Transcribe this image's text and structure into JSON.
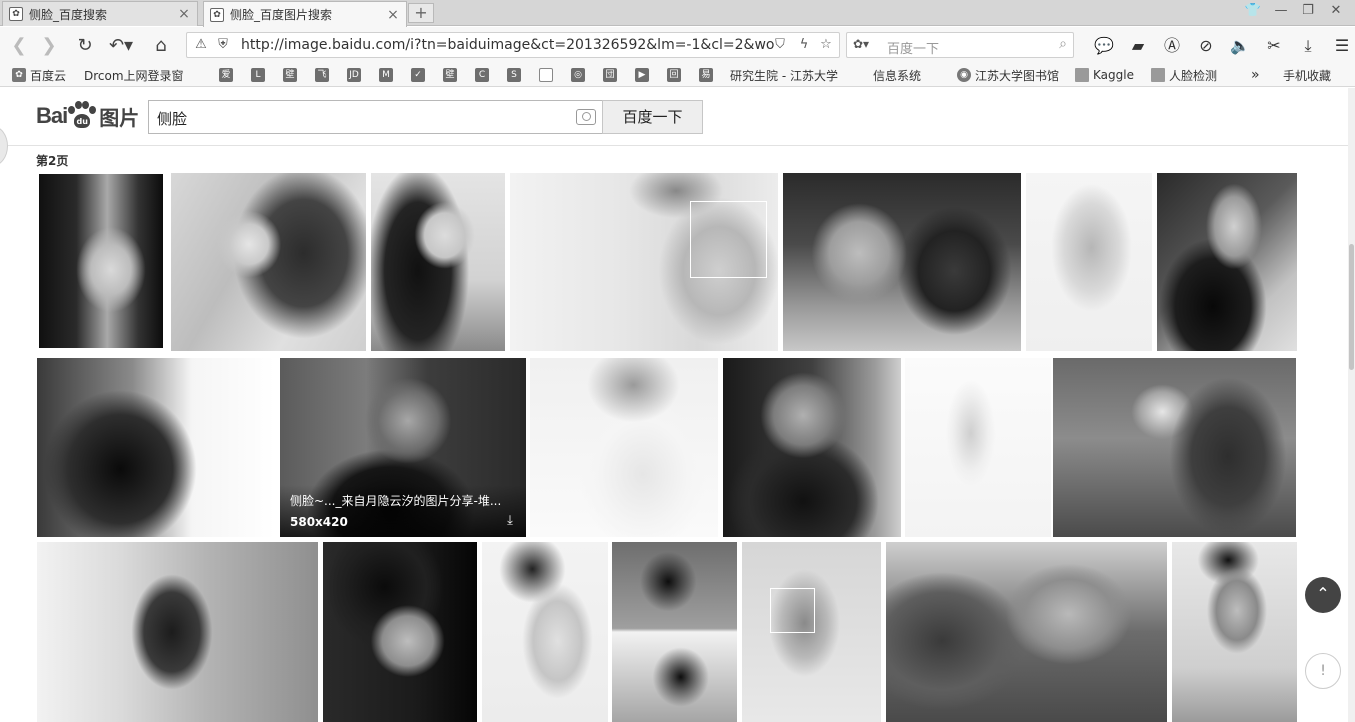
{
  "browser": {
    "tabs": [
      {
        "title": "侧脸_百度搜索",
        "active": false
      },
      {
        "title": "侧脸_百度图片搜索",
        "active": true
      }
    ],
    "url": "http://image.baidu.com/i?tn=baiduimage&ct=201326592&lm=-1&cl=2&wo",
    "search_placeholder": "百度一下",
    "bookmarks": [
      "百度云",
      "Drcom上网登录窗",
      "研究生院 - 江苏大学",
      "信息系统",
      "江苏大学图书馆",
      "Kaggle",
      "人脸检测",
      "手机收藏"
    ],
    "bookmark_icons": [
      "爱",
      "L",
      "壁",
      "飞",
      "JD",
      "M",
      "✓",
      "壁",
      "C",
      "S",
      "",
      "◎",
      "団",
      "▶",
      "回",
      "易"
    ]
  },
  "page": {
    "logo": {
      "bai": "Bai",
      "du": "du",
      "tupian": "图片"
    },
    "query": "侧脸",
    "search_button": "百度一下",
    "page_label": "第2页",
    "hover_overlay": {
      "title": "侧脸~..._来自月隐云汐的图片分享-堆...",
      "size": "580x420"
    }
  },
  "colors": {
    "tab_bg": "#d6d6d6",
    "toolbar_bg": "#f7f7f7",
    "to_top_bg": "#444444"
  }
}
